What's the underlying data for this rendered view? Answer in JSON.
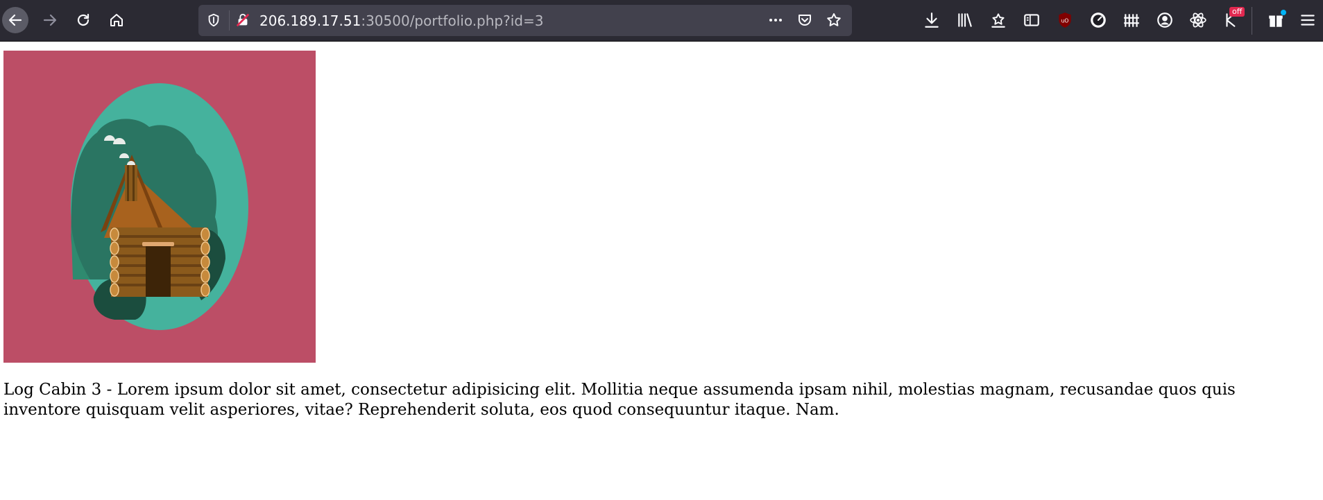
{
  "browser": {
    "url": {
      "host": "206.189.17.51",
      "rest": ":30500/portfolio.php?id=3"
    },
    "badges": {
      "off_label": "off"
    },
    "icons": {
      "back": "back-arrow-icon",
      "forward": "forward-arrow-icon",
      "reload": "reload-icon",
      "home": "home-icon",
      "tracking_shield": "shield-icon",
      "insecure": "insecure-connection-icon",
      "page_actions": "more-icon",
      "pocket": "pocket-icon",
      "bookmark": "star-icon",
      "downloads": "download-icon",
      "library": "library-icon",
      "bookmarks_menu": "bookmarks-menu-icon",
      "sidebar": "sidebar-icon",
      "ublock": "ublock-origin-icon",
      "extension_speed": "speedometer-icon",
      "extension_fence": "fence-icon",
      "account": "account-icon",
      "react_devtools": "react-icon",
      "extension_off": "arrow-off-icon",
      "whats_new": "gift-icon",
      "menu": "hamburger-menu-icon"
    },
    "colors": {
      "toolbar_bg": "#2b2a33",
      "urlbar_bg": "#42414d",
      "text_primary": "#fbfbfe",
      "text_secondary": "#b9b9c0"
    }
  },
  "page": {
    "image_alt": "Log cabin illustration",
    "image_colors": {
      "background": "#bc4e66",
      "sky_oval": "#45b29d",
      "trees_dark": "#2a7562",
      "trees_mid": "#2f8a6f",
      "bush": "#1b4d3e",
      "cabin_logs": "#8b5a1c",
      "cabin_roof": "#a8621e",
      "door": "#3d2408",
      "smoke": "#e8ece9"
    },
    "description": "Log Cabin 3 - Lorem ipsum dolor sit amet, consectetur adipisicing elit. Mollitia neque assumenda ipsam nihil, molestias magnam, recusandae quos quis inventore quisquam velit asperiores, vitae? Reprehenderit soluta, eos quod consequuntur itaque. Nam."
  }
}
